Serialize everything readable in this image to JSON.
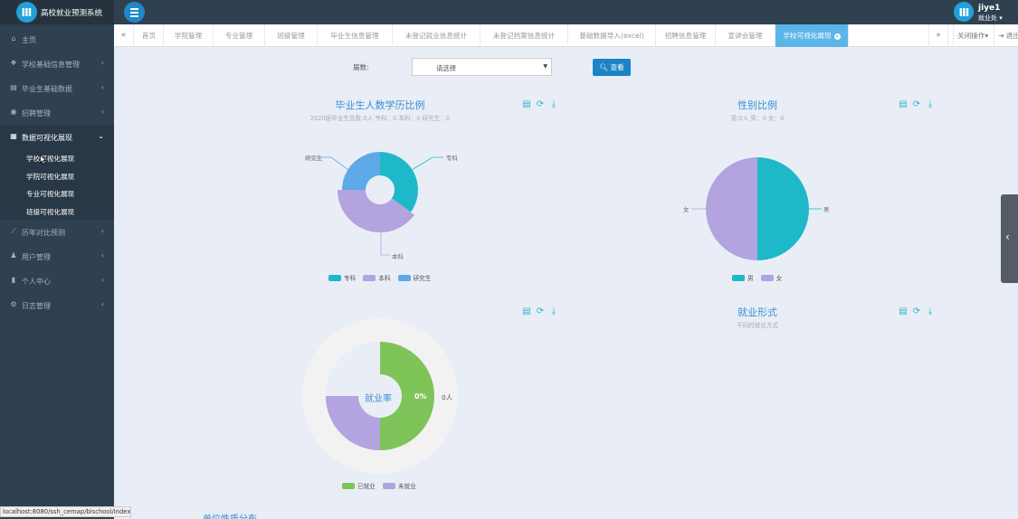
{
  "app": {
    "title": "高校就业预测系统"
  },
  "user": {
    "name": "jiye1",
    "role": "就业处"
  },
  "sidebar": {
    "items": [
      {
        "icon": "home-icon",
        "glyph": "⌂",
        "label": "主页",
        "arrow": ""
      },
      {
        "icon": "cubes-icon",
        "glyph": "❖",
        "label": "学校基础信息管理",
        "arrow": "‹"
      },
      {
        "icon": "book-icon",
        "glyph": "▤",
        "label": "毕业生基础数据",
        "arrow": "‹"
      },
      {
        "icon": "eye-icon",
        "glyph": "◉",
        "label": "招聘管理",
        "arrow": "‹"
      },
      {
        "icon": "database-icon",
        "glyph": "▦",
        "label": "数据可视化展现",
        "arrow": "⌄"
      },
      {
        "icon": "line-chart-icon",
        "glyph": "⟋",
        "label": "历年对比预测",
        "arrow": "‹"
      },
      {
        "icon": "user-icon",
        "glyph": "♟",
        "label": "用户管理",
        "arrow": "‹"
      },
      {
        "icon": "id-card-icon",
        "glyph": "▮",
        "label": "个人中心",
        "arrow": "‹"
      },
      {
        "icon": "cogs-icon",
        "glyph": "⚙",
        "label": "日志管理",
        "arrow": "‹"
      }
    ],
    "subitems": [
      "学校可视化展现",
      "学院可视化展现",
      "专业可视化展现",
      "班级可视化展现"
    ]
  },
  "tabs": {
    "items": [
      "首页",
      "学院管理",
      "专业管理",
      "班级管理",
      "毕业生信息管理",
      "未登记就业信息统计",
      "未登记档案信息统计",
      "基础数据导入(excel)",
      "招聘信息管理",
      "宣讲会管理",
      "学校可视化展现"
    ],
    "active_index": 10,
    "prev": "«",
    "next": "»",
    "close_ops": "关闭操作",
    "logout": "退出"
  },
  "filter": {
    "label": "届数:",
    "select_value": "请选择",
    "query_button": "查看"
  },
  "colors": {
    "teal": "#1fb8c9",
    "lavender": "#b3a3df",
    "blue": "#5ea9e8",
    "green": "#7fc458",
    "track": "#f2f2f2",
    "title": "#3b8fd3"
  },
  "charts": {
    "education": {
      "title": "毕业生人数学历比例",
      "subtitle": "2020届毕业生总数:0人 专科：0 本科：0 研究生：0",
      "labels": [
        "专科",
        "本科",
        "研究生"
      ],
      "legend": [
        "专科",
        "本科",
        "研究生"
      ]
    },
    "gender": {
      "title": "性别比例",
      "subtitle": "男:0人 男：0 女：0",
      "labels": [
        "男",
        "女"
      ],
      "legend": [
        "男",
        "女"
      ]
    },
    "employment_rate": {
      "center": "就业率",
      "percent": "0%",
      "count": "0人",
      "legend": [
        "已就业",
        "未就业"
      ]
    },
    "employment_form": {
      "title": "就业形式",
      "subtitle": "不同的就业方式"
    },
    "bottom_title": "单位性质分布"
  },
  "chart_data": [
    {
      "type": "pie",
      "title": "毕业生人数学历比例",
      "subtitle": "2020届毕业生总数:0人 专科：0 本科：0 研究生：0",
      "categories": [
        "专科",
        "本科",
        "研究生"
      ],
      "values": [
        0,
        0,
        0
      ],
      "visual_share": [
        0.35,
        0.4,
        0.25
      ],
      "donut": true,
      "legend": "bottom"
    },
    {
      "type": "pie",
      "title": "性别比例",
      "subtitle": "男:0人 男：0 女：0",
      "categories": [
        "男",
        "女"
      ],
      "values": [
        0,
        0
      ],
      "visual_share": [
        0.5,
        0.5
      ],
      "legend": "bottom"
    },
    {
      "type": "pie",
      "categories": [
        "已就业",
        "未就业"
      ],
      "values": [
        0,
        0
      ],
      "center_label": "就业率",
      "rate": "0%",
      "count": "0人",
      "legend": "bottom"
    }
  ],
  "status_url": "localhost:8080/ssh_cemap/bischool/index"
}
